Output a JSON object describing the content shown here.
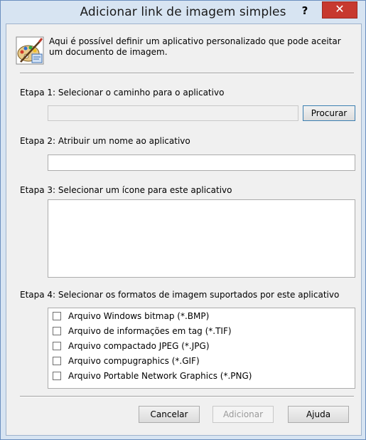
{
  "window": {
    "title": "Adicionar link de imagem simples",
    "help_glyph": "?",
    "close_glyph": "✕"
  },
  "description": "Aqui é possível definir um aplicativo personalizado que pode aceitar um documento de imagem.",
  "step1": {
    "label": "Etapa 1: Selecionar o caminho para o aplicativo",
    "path_value": "",
    "browse_label": "Procurar"
  },
  "step2": {
    "label": "Etapa 2: Atribuir um nome ao aplicativo",
    "name_value": ""
  },
  "step3": {
    "label": "Etapa 3: Selecionar um ícone para este aplicativo"
  },
  "step4": {
    "label": "Etapa 4: Selecionar os formatos de imagem suportados por este aplicativo",
    "formats": [
      {
        "label": "Arquivo Windows bitmap (*.BMP)",
        "checked": false
      },
      {
        "label": "Arquivo de informações em tag (*.TIF)",
        "checked": false
      },
      {
        "label": "Arquivo compactado JPEG (*.JPG)",
        "checked": false
      },
      {
        "label": "Arquivo compugraphics (*.GIF)",
        "checked": false
      },
      {
        "label": "Arquivo Portable Network Graphics (*.PNG)",
        "checked": false
      }
    ]
  },
  "buttons": {
    "cancel": "Cancelar",
    "add": "Adicionar",
    "help": "Ajuda"
  },
  "colors": {
    "title_bar": "#d7e4f2",
    "close_button": "#c7392f",
    "dialog_body": "#f0f0f0"
  }
}
